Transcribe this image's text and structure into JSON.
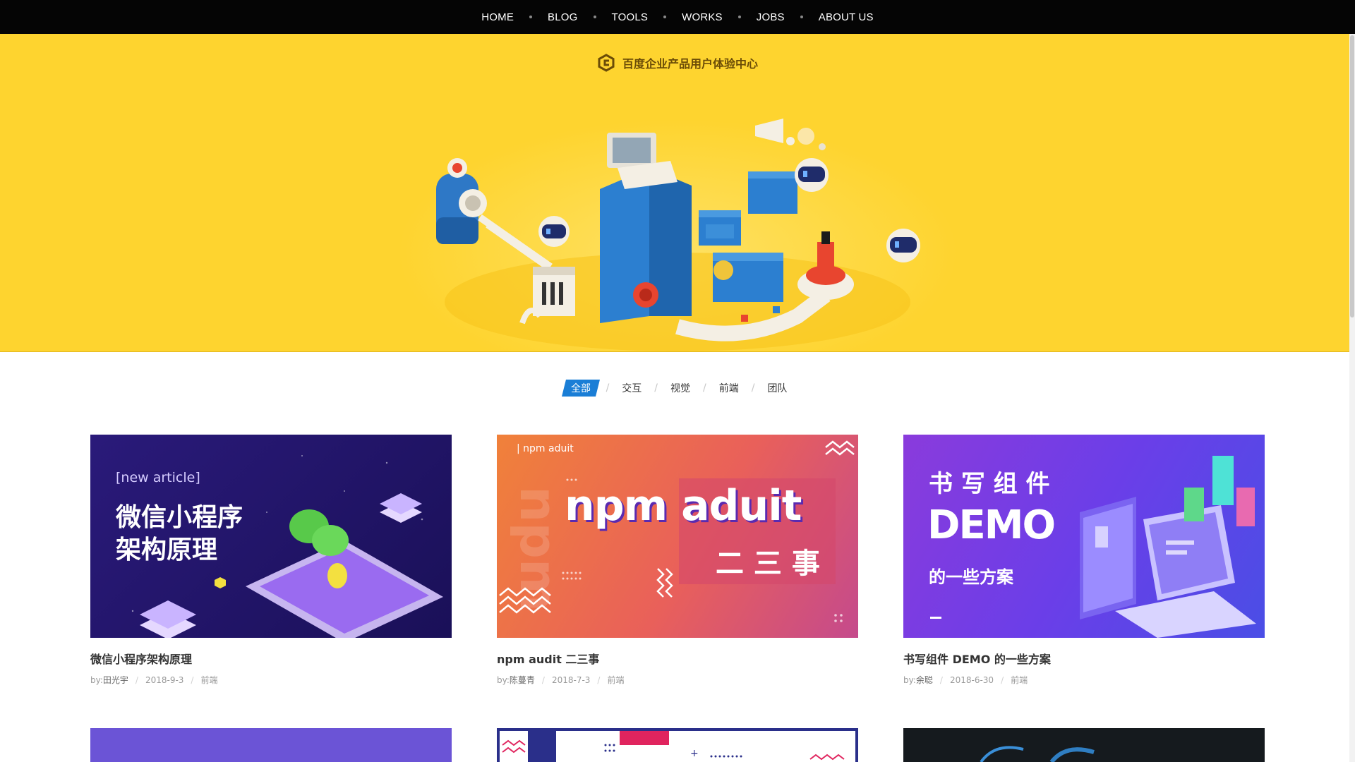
{
  "nav": {
    "items": [
      "HOME",
      "BLOG",
      "TOOLS",
      "WORKS",
      "JOBS",
      "ABOUT US"
    ]
  },
  "hero": {
    "brand": "百度企业产品用户体验中心",
    "bg_color": "#fed42f"
  },
  "filters": {
    "items": [
      "全部",
      "交互",
      "视觉",
      "前端",
      "团队"
    ],
    "active": "全部",
    "accent": "#1a7ed6"
  },
  "posts": [
    {
      "thumb_tag": "[new article]",
      "thumb_line1": "微信小程序",
      "thumb_line2": "架构原理",
      "title": "微信小程序架构原理",
      "author_prefix": "by:",
      "author": "田光宇",
      "date": "2018-9-3",
      "category": "前端"
    },
    {
      "thumb_tag": "| npm aduit",
      "thumb_line1": "npm aduit",
      "thumb_line2": "二 三 事",
      "thumb_vertical": "npm",
      "title": "npm audit 二三事",
      "author_prefix": "by:",
      "author": "陈蔓青",
      "date": "2018-7-3",
      "category": "前端"
    },
    {
      "thumb_line1": "书 写 组 件",
      "thumb_line2": "DEMO",
      "thumb_line3": "的一些方案",
      "title": "书写组件 DEMO 的一些方案",
      "author_prefix": "by:",
      "author": "余聪",
      "date": "2018-6-30",
      "category": "前端"
    }
  ]
}
